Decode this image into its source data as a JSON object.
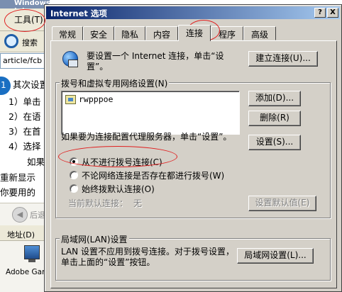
{
  "background": {
    "window_title": "Windows Internet Ex",
    "menu_tools": "工具(T)",
    "search_label": "搜索",
    "address_text": "article/fcb",
    "step_number": "1",
    "content_lines": [
      "其次设置",
      "1）单击",
      "2）在语",
      "3）在首",
      "4）选择",
      "如果",
      "重新显示",
      "你要用的"
    ],
    "back_label": "后退",
    "address_label": "地址(D)",
    "desktop_icon_label": "Adobe Gam"
  },
  "dialog": {
    "title": "Internet 选项",
    "help_button": "?",
    "close_button": "X",
    "tabs": [
      "常规",
      "安全",
      "隐私",
      "内容",
      "连接",
      "程序",
      "高级"
    ],
    "active_tab": "连接",
    "setup_text": "要设置一个 Internet 连接，单击“设置”。",
    "setup_button": "建立连接(U)...",
    "dialup_group_label": "拨号和虚拟专用网络设置(N)",
    "connections": [
      "rwpppoe"
    ],
    "add_button": "添加(D)...",
    "delete_button": "删除(R)",
    "proxy_text": "如果要为连接配置代理服务器，单击“设置”。",
    "settings_button": "设置(S)...",
    "radio_options": [
      {
        "label": "从不进行拨号连接(C)",
        "checked": true
      },
      {
        "label": "不论网络连接是否存在都进行拨号(W)",
        "checked": false
      },
      {
        "label": "始终拨默认连接(O)",
        "checked": false
      }
    ],
    "default_label": "当前默认连接：",
    "default_value": "无",
    "set_default_button": "设置默认值(E)",
    "lan_group_label": "局域网(LAN)设置",
    "lan_text": "LAN 设置不应用到拨号连接。对于拨号设置，单击上面的“设置”按钮。",
    "lan_button": "局域网设置(L)..."
  }
}
